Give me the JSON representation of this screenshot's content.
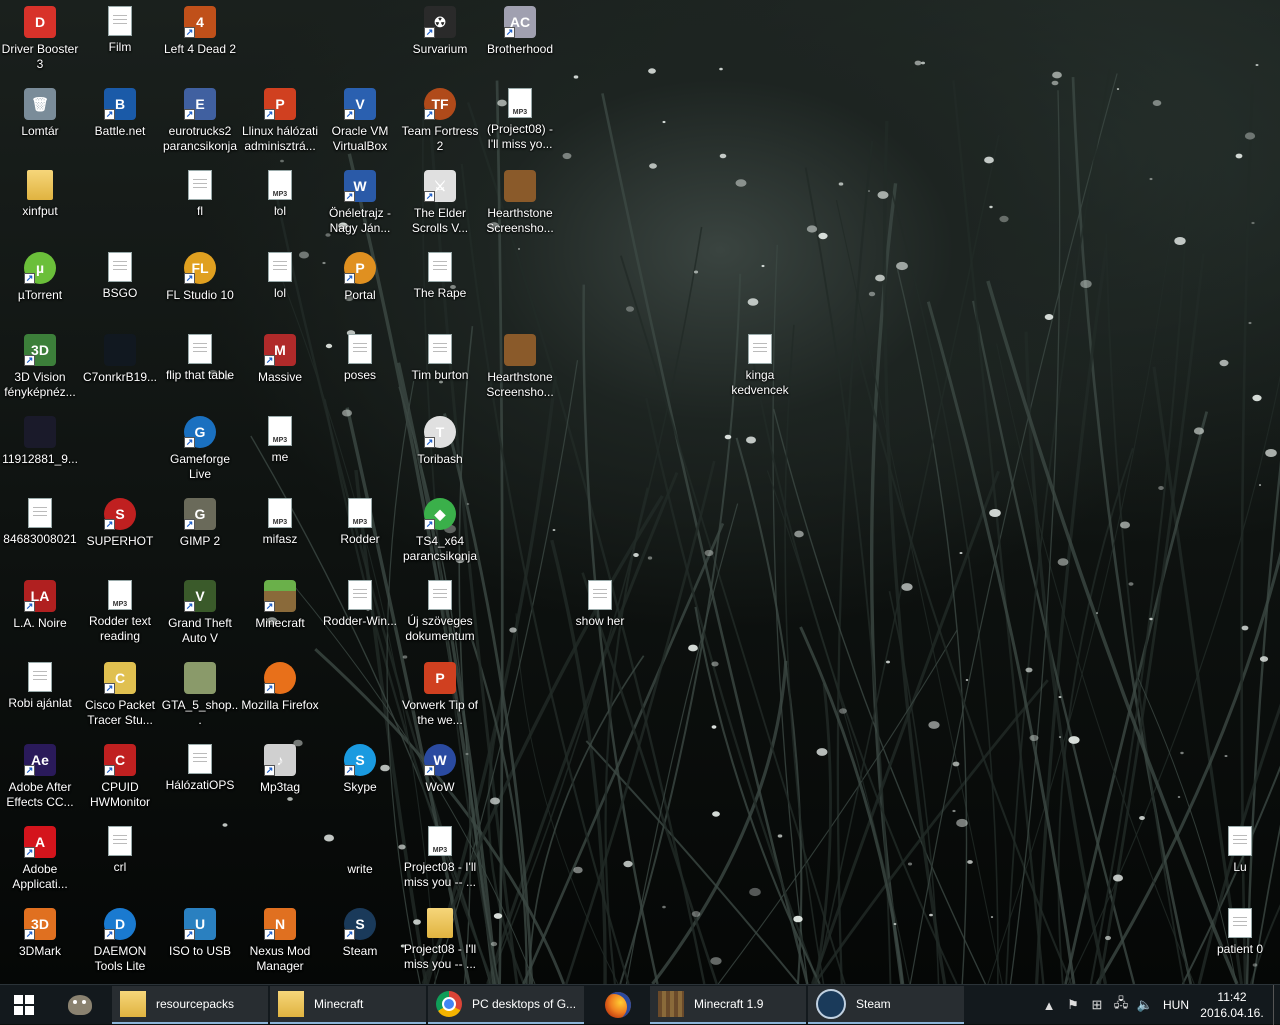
{
  "desktop_icons": [
    {
      "label": "Driver Booster 3",
      "col": 0,
      "row": 0,
      "kind": "app",
      "color": "#d8322a",
      "glyph": "D",
      "shortcut": false
    },
    {
      "label": "Lomtár",
      "col": 0,
      "row": 1,
      "kind": "app",
      "color": "#7a8c99",
      "glyph": "🗑",
      "shortcut": false
    },
    {
      "label": "xinfput",
      "col": 0,
      "row": 2,
      "kind": "folder",
      "color": "#e8c35a",
      "glyph": "",
      "shortcut": false
    },
    {
      "label": "µTorrent",
      "col": 0,
      "row": 3,
      "kind": "round",
      "color": "#6bbf3a",
      "glyph": "µ",
      "shortcut": true
    },
    {
      "label": "3D Vision fényképnéz...",
      "col": 0,
      "row": 4,
      "kind": "app",
      "color": "#3c7f3a",
      "glyph": "3D",
      "shortcut": true
    },
    {
      "label": "11912881_9...",
      "col": 0,
      "row": 5,
      "kind": "app",
      "color": "#1a1a2a",
      "glyph": "",
      "shortcut": false
    },
    {
      "label": "84683008021",
      "col": 0,
      "row": 6,
      "kind": "doc",
      "color": "#ffffff",
      "glyph": "",
      "shortcut": false
    },
    {
      "label": "L.A. Noire",
      "col": 0,
      "row": 7,
      "kind": "app",
      "color": "#b02020",
      "glyph": "LA",
      "shortcut": true
    },
    {
      "label": "Robi ajánlat",
      "col": 0,
      "row": 8,
      "kind": "doc",
      "color": "#ffffff",
      "glyph": "",
      "shortcut": false
    },
    {
      "label": "Adobe After Effects CC...",
      "col": 0,
      "row": 9,
      "kind": "app",
      "color": "#2a1a5a",
      "glyph": "Ae",
      "shortcut": true
    },
    {
      "label": "Adobe Applicati...",
      "col": 0,
      "row": 10,
      "kind": "app",
      "color": "#d4141c",
      "glyph": "A",
      "shortcut": true
    },
    {
      "label": "3DMark",
      "col": 0,
      "row": 11,
      "kind": "app",
      "color": "#e07020",
      "glyph": "3D",
      "shortcut": true
    },
    {
      "label": "Film",
      "col": 1,
      "row": 0,
      "kind": "doc",
      "color": "#ffffff",
      "glyph": "",
      "shortcut": false
    },
    {
      "label": "Battle.net",
      "col": 1,
      "row": 1,
      "kind": "app",
      "color": "#1a5aa8",
      "glyph": "B",
      "shortcut": true
    },
    {
      "label": "BSGO",
      "col": 1,
      "row": 3,
      "kind": "doc",
      "color": "#ffffff",
      "glyph": "",
      "shortcut": false
    },
    {
      "label": "C7onrkrB19...",
      "col": 1,
      "row": 4,
      "kind": "app",
      "color": "#111820",
      "glyph": "",
      "shortcut": false
    },
    {
      "label": "SUPERHOT",
      "col": 1,
      "row": 6,
      "kind": "round",
      "color": "#c02020",
      "glyph": "S",
      "shortcut": true
    },
    {
      "label": "Rodder text reading",
      "col": 1,
      "row": 7,
      "kind": "mp3",
      "color": "#ffffff",
      "glyph": "♪",
      "shortcut": false
    },
    {
      "label": "Cisco Packet Tracer Stu...",
      "col": 1,
      "row": 8,
      "kind": "app",
      "color": "#e0c050",
      "glyph": "C",
      "shortcut": true
    },
    {
      "label": "CPUID HWMonitor",
      "col": 1,
      "row": 9,
      "kind": "app",
      "color": "#c02020",
      "glyph": "C",
      "shortcut": true
    },
    {
      "label": "crl",
      "col": 1,
      "row": 10,
      "kind": "doc",
      "color": "#ffffff",
      "glyph": "",
      "shortcut": false
    },
    {
      "label": "DAEMON Tools Lite",
      "col": 1,
      "row": 11,
      "kind": "round",
      "color": "#1a7ad0",
      "glyph": "D",
      "shortcut": true
    },
    {
      "label": "Left 4 Dead 2",
      "col": 2,
      "row": 0,
      "kind": "app",
      "color": "#c0501a",
      "glyph": "4",
      "shortcut": true
    },
    {
      "label": "eurotrucks2 parancsikonja",
      "col": 2,
      "row": 1,
      "kind": "app",
      "color": "#4060a0",
      "glyph": "E",
      "shortcut": true
    },
    {
      "label": "fl",
      "col": 2,
      "row": 2,
      "kind": "doc",
      "color": "#ffffff",
      "glyph": "",
      "shortcut": false
    },
    {
      "label": "FL Studio 10",
      "col": 2,
      "row": 3,
      "kind": "round",
      "color": "#e0a020",
      "glyph": "FL",
      "shortcut": true
    },
    {
      "label": "flip that table",
      "col": 2,
      "row": 4,
      "kind": "doc",
      "color": "#ffffff",
      "glyph": "",
      "shortcut": false
    },
    {
      "label": "Gameforge Live",
      "col": 2,
      "row": 5,
      "kind": "round",
      "color": "#1a70c0",
      "glyph": "G",
      "shortcut": true
    },
    {
      "label": "GIMP 2",
      "col": 2,
      "row": 6,
      "kind": "app",
      "color": "#6a6a5a",
      "glyph": "G",
      "shortcut": true
    },
    {
      "label": "Grand Theft Auto V",
      "col": 2,
      "row": 7,
      "kind": "app",
      "color": "#3a5a2a",
      "glyph": "V",
      "shortcut": true
    },
    {
      "label": "GTA_5_shop...",
      "col": 2,
      "row": 8,
      "kind": "app",
      "color": "#8a9a6a",
      "glyph": "",
      "shortcut": false
    },
    {
      "label": "HálózatiOPS",
      "col": 2,
      "row": 9,
      "kind": "doc",
      "color": "#ffffff",
      "glyph": "",
      "shortcut": false
    },
    {
      "label": "ISO to USB",
      "col": 2,
      "row": 11,
      "kind": "app",
      "color": "#2a80c0",
      "glyph": "U",
      "shortcut": true
    },
    {
      "label": "Llinux hálózati adminisztrá...",
      "col": 3,
      "row": 1,
      "kind": "app",
      "color": "#d04020",
      "glyph": "P",
      "shortcut": true
    },
    {
      "label": "lol",
      "col": 3,
      "row": 2,
      "kind": "mp3",
      "color": "#ffffff",
      "glyph": "♪",
      "shortcut": false
    },
    {
      "label": "lol",
      "col": 3,
      "row": 3,
      "kind": "doc",
      "color": "#ffffff",
      "glyph": "",
      "shortcut": false
    },
    {
      "label": "Massive",
      "col": 3,
      "row": 4,
      "kind": "app",
      "color": "#b02a2a",
      "glyph": "M",
      "shortcut": true
    },
    {
      "label": "me",
      "col": 3,
      "row": 5,
      "kind": "mp3",
      "color": "#ffffff",
      "glyph": "♪",
      "shortcut": false
    },
    {
      "label": "mifasz",
      "col": 3,
      "row": 6,
      "kind": "mp3",
      "color": "#ffffff",
      "glyph": "♪",
      "shortcut": false
    },
    {
      "label": "Minecraft",
      "col": 3,
      "row": 7,
      "kind": "app",
      "color": "#5a9a3a",
      "glyph": "",
      "shortcut": true
    },
    {
      "label": "Mozilla Firefox",
      "col": 3,
      "row": 8,
      "kind": "round",
      "color": "#e8701a",
      "glyph": "",
      "shortcut": true
    },
    {
      "label": "Mp3tag",
      "col": 3,
      "row": 9,
      "kind": "app",
      "color": "#d0d0d0",
      "glyph": "♪",
      "shortcut": true
    },
    {
      "label": "Nexus Mod Manager",
      "col": 3,
      "row": 11,
      "kind": "app",
      "color": "#e07020",
      "glyph": "N",
      "shortcut": true
    },
    {
      "label": "Oracle VM VirtualBox",
      "col": 4,
      "row": 1,
      "kind": "app",
      "color": "#2a60b0",
      "glyph": "V",
      "shortcut": true
    },
    {
      "label": "Önéletrajz - Nagy Ján...",
      "col": 4,
      "row": 2,
      "kind": "app",
      "color": "#2a5aa8",
      "glyph": "W",
      "shortcut": true
    },
    {
      "label": "Portal",
      "col": 4,
      "row": 3,
      "kind": "round",
      "color": "#e09020",
      "glyph": "P",
      "shortcut": true
    },
    {
      "label": "poses",
      "col": 4,
      "row": 4,
      "kind": "doc",
      "color": "#ffffff",
      "glyph": "",
      "shortcut": false
    },
    {
      "label": "Rodder",
      "col": 4,
      "row": 6,
      "kind": "mp3",
      "color": "#ffffff",
      "glyph": "♪",
      "shortcut": false
    },
    {
      "label": "Rodder-Win...",
      "col": 4,
      "row": 7,
      "kind": "doc",
      "color": "#ffffff",
      "glyph": "",
      "shortcut": false
    },
    {
      "label": "Skype",
      "col": 4,
      "row": 9,
      "kind": "round",
      "color": "#1a9ae0",
      "glyph": "S",
      "shortcut": true
    },
    {
      "label": "write",
      "col": 4,
      "row": 10,
      "kind": "none",
      "color": "",
      "glyph": "",
      "shortcut": false
    },
    {
      "label": "Steam",
      "col": 4,
      "row": 11,
      "kind": "round",
      "color": "#1a3a5a",
      "glyph": "S",
      "shortcut": true
    },
    {
      "label": "Survarium",
      "col": 5,
      "row": 0,
      "kind": "app",
      "color": "#2a2a2a",
      "glyph": "☢",
      "shortcut": true
    },
    {
      "label": "Team Fortress 2",
      "col": 5,
      "row": 1,
      "kind": "round",
      "color": "#b04a1a",
      "glyph": "TF",
      "shortcut": true
    },
    {
      "label": "The Elder Scrolls V...",
      "col": 5,
      "row": 2,
      "kind": "app",
      "color": "#e0e0e0",
      "glyph": "⚔",
      "shortcut": true
    },
    {
      "label": "The Rape",
      "col": 5,
      "row": 3,
      "kind": "doc",
      "color": "#ffffff",
      "glyph": "",
      "shortcut": false
    },
    {
      "label": "Tim burton",
      "col": 5,
      "row": 4,
      "kind": "doc",
      "color": "#ffffff",
      "glyph": "",
      "shortcut": false
    },
    {
      "label": "Toribash",
      "col": 5,
      "row": 5,
      "kind": "round",
      "color": "#e0e0e0",
      "glyph": "T",
      "shortcut": true
    },
    {
      "label": "TS4_x64 parancsikonja",
      "col": 5,
      "row": 6,
      "kind": "round",
      "color": "#3ab04a",
      "glyph": "◆",
      "shortcut": true
    },
    {
      "label": "Új szöveges dokumentum",
      "col": 5,
      "row": 7,
      "kind": "doc",
      "color": "#ffffff",
      "glyph": "",
      "shortcut": false
    },
    {
      "label": "Vorwerk Tip of the we...",
      "col": 5,
      "row": 8,
      "kind": "app",
      "color": "#d04020",
      "glyph": "P",
      "shortcut": false
    },
    {
      "label": "WoW",
      "col": 5,
      "row": 9,
      "kind": "round",
      "color": "#2a4aa0",
      "glyph": "W",
      "shortcut": true
    },
    {
      "label": "Project08 - I'll miss you -- ...",
      "col": 5,
      "row": 10,
      "kind": "mp3",
      "color": "#ffffff",
      "glyph": "♪",
      "shortcut": false
    },
    {
      "label": "Project08 - I'll miss you -- ...",
      "col": 5,
      "row": 11,
      "kind": "folder",
      "color": "#e8c35a",
      "glyph": "",
      "shortcut": false
    },
    {
      "label": "Brotherhood",
      "col": 6,
      "row": 0,
      "kind": "app",
      "color": "#a0a0b0",
      "glyph": "AC",
      "shortcut": true
    },
    {
      "label": "(Project08) - I'll miss yo...",
      "col": 6,
      "row": 1,
      "kind": "mp3",
      "color": "#ffffff",
      "glyph": "♪",
      "shortcut": false
    },
    {
      "label": "Hearthstone Screensho...",
      "col": 6,
      "row": 2,
      "kind": "app",
      "color": "#8a5a2a",
      "glyph": "",
      "shortcut": false
    },
    {
      "label": "Hearthstone Screensho...",
      "col": 6,
      "row": 4,
      "kind": "app",
      "color": "#8a5a2a",
      "glyph": "",
      "shortcut": false
    },
    {
      "label": "show her",
      "col": 7,
      "row": 7,
      "kind": "doc",
      "color": "#ffffff",
      "glyph": "",
      "shortcut": false
    },
    {
      "label": "kinga kedvencek",
      "col": 9,
      "row": 4,
      "kind": "doc",
      "color": "#ffffff",
      "glyph": "",
      "shortcut": false
    },
    {
      "label": "Lu",
      "col": 15,
      "row": 10,
      "kind": "doc",
      "color": "#ffffff",
      "glyph": "",
      "shortcut": false
    },
    {
      "label": "patient 0",
      "col": 15,
      "row": 11,
      "kind": "doc",
      "color": "#ffffff",
      "glyph": "",
      "shortcut": false
    }
  ],
  "taskbar": {
    "start_icon": "windows-logo",
    "pinned": [
      {
        "name": "gimp-pinned",
        "icon": "gimp-icon"
      },
      {
        "name": "firefox-pinned",
        "icon": "firefox-icon"
      }
    ],
    "windows": [
      {
        "label": "resourcepacks",
        "icon": "folder-icon",
        "color": "#e8c35a"
      },
      {
        "label": "Minecraft",
        "icon": "folder-icon",
        "color": "#e8c35a"
      },
      {
        "label": "PC desktops of G...",
        "icon": "chrome-icon",
        "color": "#4a8ae0"
      },
      {
        "label": "Minecraft 1.9",
        "icon": "minecraft-icon",
        "color": "#6a4a2a"
      },
      {
        "label": "Steam",
        "icon": "steam-icon",
        "color": "#1a3a5a"
      }
    ],
    "tray": {
      "language": "HUN",
      "time": "11:42",
      "date": "2016.04.16."
    }
  }
}
